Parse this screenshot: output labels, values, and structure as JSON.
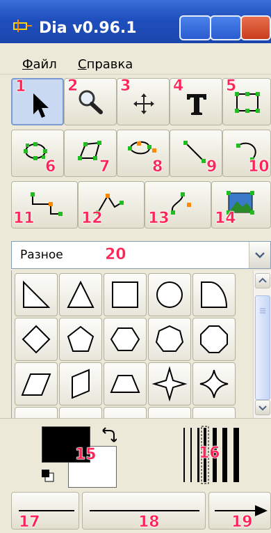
{
  "window": {
    "title": "Dia v0.96.1"
  },
  "menu": [
    {
      "underline": "Ф",
      "rest": "айл"
    },
    {
      "underline": "С",
      "rest": "правка"
    }
  ],
  "tool_numbers": [
    "1",
    "2",
    "3",
    "4",
    "5",
    "6",
    "7",
    "8",
    "9",
    "10",
    "11",
    "12",
    "13",
    "14"
  ],
  "sheet": {
    "selected": "Разное",
    "number": "20"
  },
  "colors_number": "15",
  "linewidth_number": "16",
  "line_numbers": [
    "17",
    "18",
    "19"
  ],
  "colors": {
    "accent": "#ff2255",
    "foreground": "#000000",
    "background": "#ffffff"
  }
}
